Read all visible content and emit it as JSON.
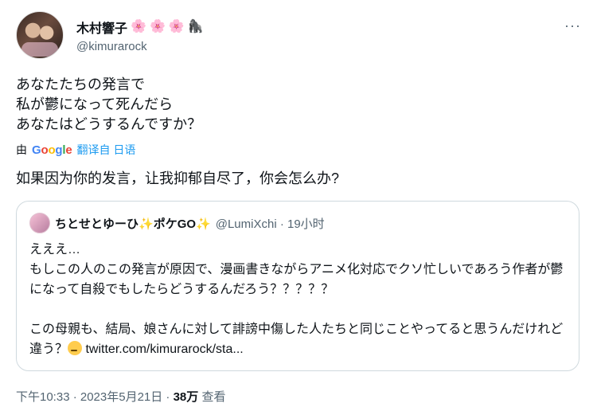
{
  "author": {
    "display_name": "木村響子",
    "handle": "@kimurarock"
  },
  "more_label": "···",
  "tweet": {
    "text": "あなたたちの発言で\n私が鬱になって死んだら\nあなたはどうするんですか？",
    "translation_prefix": "由",
    "google_letters": [
      "G",
      "o",
      "o",
      "g",
      "l",
      "e"
    ],
    "translation_source": "翻译自 日语",
    "translated_text": "如果因为你的发言，让我抑郁自尽了，你会怎么办?"
  },
  "quote": {
    "display_name": "ちとせとゆーひ",
    "name_suffix": "ポケGO",
    "handle_meta": "@LumiXchi · 19小时",
    "body": "えええ…\nもしこの人のこの発言が原因で、漫画書きながらアニメ化対応でクソ忙しいであろう作者が鬱になって自殺でもしたらどうするんだろう？？？？？\n\nこの母親も、結局、娘さんに対して誹謗中傷した人たちと同じことやってると思うんだけれど違う？",
    "link": "twitter.com/kimurarock/sta..."
  },
  "footer": {
    "time_date": "下午10:33 · 2023年5月21日 · ",
    "views_count": "38万",
    "views_label": " 查看"
  }
}
